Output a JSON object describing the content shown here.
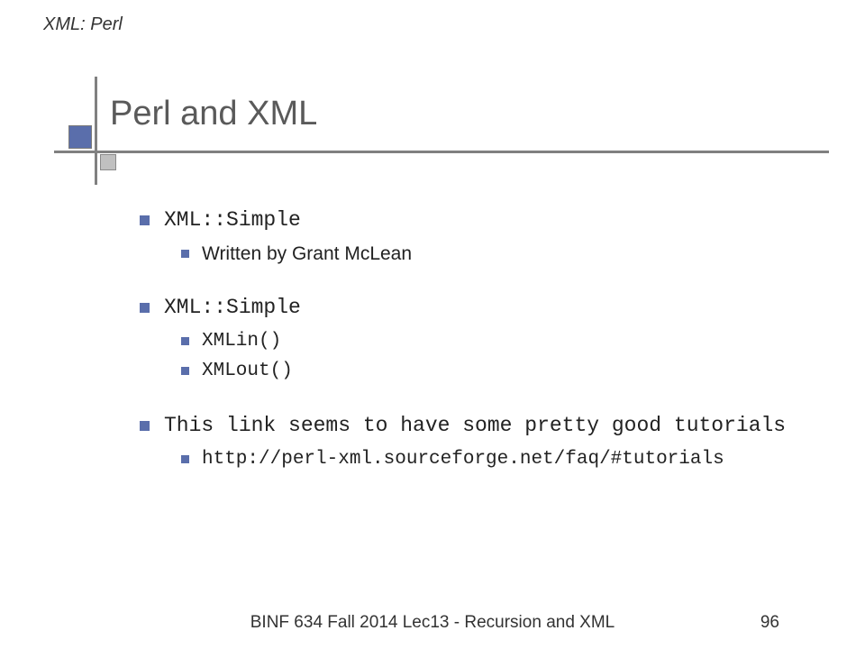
{
  "header": {
    "label": "XML: Perl"
  },
  "slide": {
    "title": "Perl and XML",
    "items": [
      {
        "level": 1,
        "text": "XML::Simple",
        "font": "mono"
      },
      {
        "level": 2,
        "text": "Written by Grant McLean",
        "font": "sans"
      },
      {
        "level": 0,
        "gap": true
      },
      {
        "level": 1,
        "text": "XML::Simple",
        "font": "mono"
      },
      {
        "level": 2,
        "text": "XMLin()",
        "font": "mono"
      },
      {
        "level": 2,
        "text": "XMLout()",
        "font": "mono"
      },
      {
        "level": 0,
        "gap": true
      },
      {
        "level": 1,
        "text": "This link seems to have some pretty good tutorials",
        "font": "mono"
      },
      {
        "level": 2,
        "text": "http://perl-xml.sourceforge.net/faq/#tutorials",
        "font": "mono"
      }
    ]
  },
  "footer": {
    "text": "BINF 634 Fall 2014  Lec13 - Recursion and XML",
    "page": "96"
  }
}
